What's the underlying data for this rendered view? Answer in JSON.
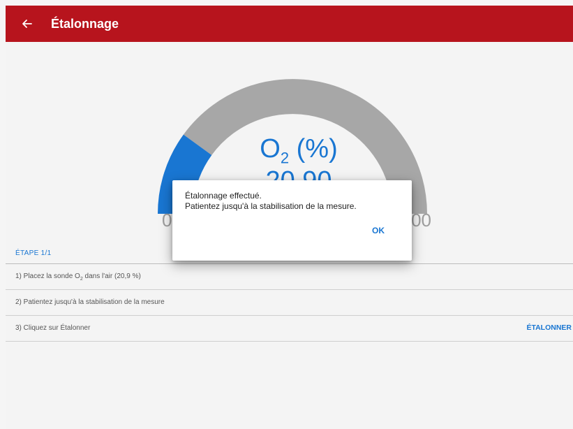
{
  "appbar": {
    "title": "Étalonnage",
    "back_icon": "arrow-left-icon"
  },
  "gauge": {
    "label_main": "O",
    "label_sub": "2",
    "label_unit": " (%)",
    "value": "20.90",
    "min_label": "0",
    "max_label": "00",
    "fraction_filled": 0.2,
    "colors": {
      "fill": "#1976d2",
      "track": "#9e9e9e"
    }
  },
  "step": {
    "header": "ÉTAPE 1/1",
    "rows": [
      {
        "text_before": "1) Placez la sonde O",
        "sub": "2",
        "text_after": " dans l'air (20,9 %)"
      },
      {
        "text": "2) Patientez jusqu'à la stabilisation de la mesure"
      },
      {
        "text": "3) Cliquez sur Étalonner",
        "action": "ÉTALONNER"
      }
    ]
  },
  "dialog": {
    "line1": "Étalonnage effectué.",
    "line2": "Patientez jusqu'à la stabilisation de la mesure.",
    "ok": "OK"
  },
  "colors": {
    "appbar": "#b7141d",
    "accent": "#1976d2"
  }
}
